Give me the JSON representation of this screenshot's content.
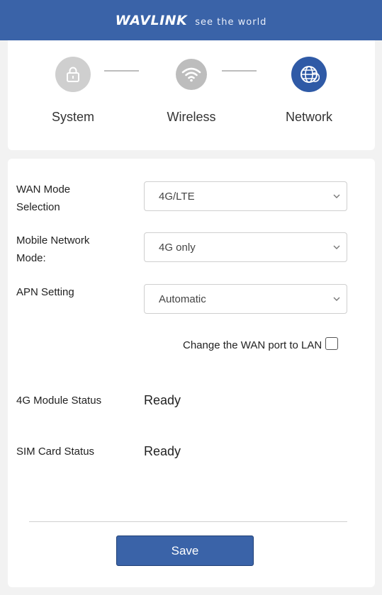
{
  "header": {
    "brand": "WAVLINK",
    "tagline": "see the world",
    "accent": "#3a63a8"
  },
  "steps": [
    {
      "label": "System",
      "icon": "lock-icon",
      "state": "done"
    },
    {
      "label": "Wireless",
      "icon": "wifi-icon",
      "state": "done"
    },
    {
      "label": "Network",
      "icon": "globe-icon",
      "state": "active"
    }
  ],
  "form": {
    "wan_mode": {
      "label": "WAN Mode Selection",
      "value": "4G/LTE"
    },
    "mobile_mode": {
      "label": "Mobile Network Mode:",
      "value": "4G only"
    },
    "apn": {
      "label": "APN Setting",
      "value": "Automatic"
    },
    "wan_to_lan": {
      "label": "Change the WAN port to LAN",
      "checked": false
    },
    "module_status": {
      "label": "4G Module Status",
      "value": "Ready"
    },
    "sim_status": {
      "label": "SIM Card Status",
      "value": "Ready"
    }
  },
  "actions": {
    "save_label": "Save"
  }
}
